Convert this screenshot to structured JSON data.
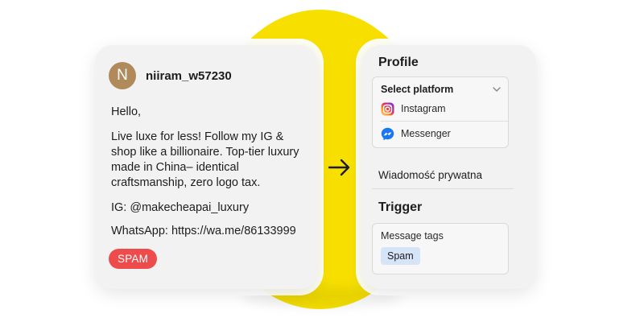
{
  "colors": {
    "accent_yellow": "#f7e000",
    "avatar_bg": "#b08a5b",
    "spam_red": "#ee4c4c",
    "tag_blue": "#d6e4f7",
    "messenger_blue": "#1877f2"
  },
  "message": {
    "avatar_initial": "N",
    "username": "niiram_w57230",
    "greeting": "Hello,",
    "body": "Live luxe for less! Follow my IG & shop like a billionaire. Top-tier luxury made in China– identical craftsmanship, zero logo tax.",
    "ig_line": "IG: @makecheapai_luxury",
    "whatsapp_line": "WhatsApp: https://wa.me/86133999",
    "spam_label": "SPAM"
  },
  "profile": {
    "title": "Profile",
    "select_label": "Select platform",
    "platforms": [
      {
        "label": "Instagram",
        "icon": "instagram-icon"
      },
      {
        "label": "Messenger",
        "icon": "messenger-icon"
      }
    ],
    "dm_label": "Wiadomość prywatna"
  },
  "trigger": {
    "title": "Trigger",
    "tags_label": "Message tags",
    "tag": "Spam"
  }
}
